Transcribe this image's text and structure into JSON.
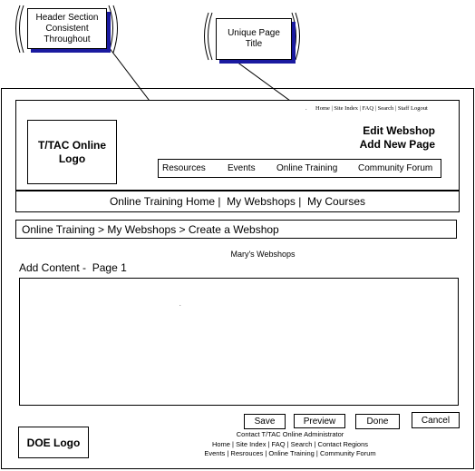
{
  "annotations": {
    "header_callout": "Header Section\nConsistent\nThroughout",
    "title_callout": "Unique Page\nTitle"
  },
  "header": {
    "utility_links": "Home | Site Index | FAQ | Search | Staff Logout",
    "logo": "T/TAC Online\nLogo",
    "page_title_line1": "Edit Webshop",
    "page_title_line2": "Add  New Page",
    "nav": [
      "Resources",
      "Events",
      "Online Training",
      "Community Forum"
    ]
  },
  "subnav": "Online Training Home |  My Webshops |  My Courses",
  "breadcrumb": "Online Training > My Webshops > Create a Webshop",
  "section_title": "Mary's Webshops",
  "content_label": "Add Content -  Page 1",
  "buttons": {
    "save": "Save",
    "preview": "Preview",
    "done": "Done",
    "cancel": "Cancel"
  },
  "footer": {
    "logo": "DOE Logo",
    "contact": "Contact T/TAC Online Administrator",
    "links1": "Home | Site Index | FAQ | Search | Contact Regions",
    "links2": "Events | Resrouces | Online Training | Community Forum"
  }
}
